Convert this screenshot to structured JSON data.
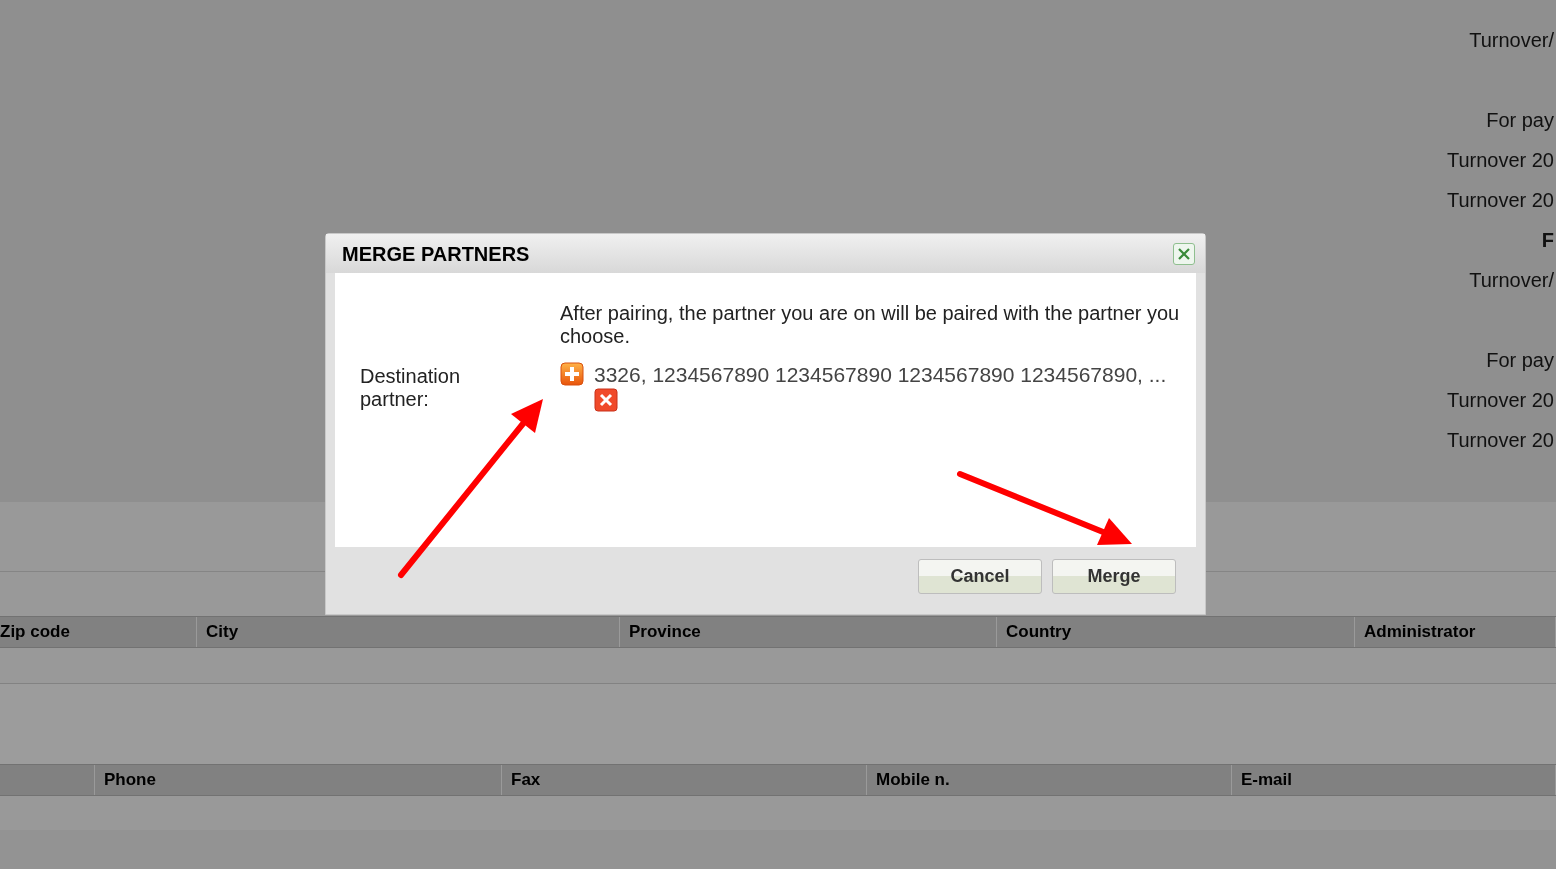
{
  "side_labels": [
    {
      "items": [
        {
          "text": "Turnover/",
          "kind": "label"
        }
      ]
    },
    {
      "items": [
        {
          "text": "For pay",
          "kind": "label"
        },
        {
          "text": "Turnover 20",
          "kind": "label"
        },
        {
          "text": "Turnover 20",
          "kind": "label"
        },
        {
          "text": "F",
          "kind": "heading"
        },
        {
          "text": "Turnover/",
          "kind": "label"
        }
      ]
    },
    {
      "items": [
        {
          "text": "For pay",
          "kind": "label"
        },
        {
          "text": "Turnover 20",
          "kind": "label"
        },
        {
          "text": "Turnover 20",
          "kind": "label"
        }
      ]
    }
  ],
  "address_table": {
    "columns": [
      "Zip code",
      "City",
      "Province",
      "Country",
      "Administrator"
    ]
  },
  "contact_table": {
    "columns": [
      "Phone",
      "Fax",
      "Mobile n.",
      "E-mail"
    ]
  },
  "dialog": {
    "title": "MERGE PARTNERS",
    "message": "After pairing, the partner you are on will be paired with the partner you choose.",
    "field_label": "Destination partner:",
    "field_value": "3326, 1234567890 1234567890 1234567890 1234567890, ...",
    "buttons": [
      "Cancel",
      "Merge"
    ]
  }
}
